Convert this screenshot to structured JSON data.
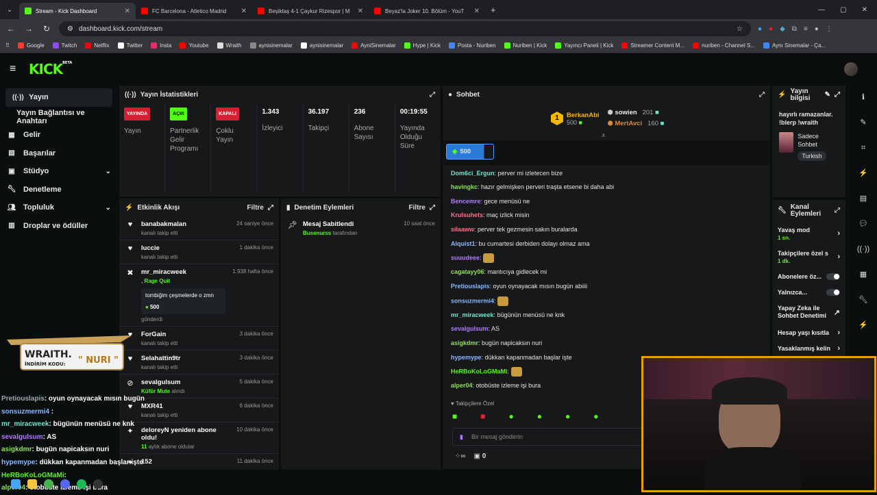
{
  "browser": {
    "tabs": [
      {
        "label": "Stream - Kick Dashboard",
        "color": "#53fc18",
        "active": true
      },
      {
        "label": "FC Barcelona - Atletico Madrid",
        "color": "#ff0000",
        "active": false
      },
      {
        "label": "Beşiktaş 4-1 Çaykur Rizespor | M",
        "color": "#ff0000",
        "active": false
      },
      {
        "label": "Beyaz'la Joker 10. Bölüm - YouT",
        "color": "#ff0000",
        "active": false
      }
    ],
    "url": "dashboard.kick.com/stream",
    "bookmarks": [
      "Google",
      "Twitch",
      "Netflix",
      "Twitter",
      "Insta",
      "Youtube",
      "Wraith",
      "aynisinemalar",
      "aynisinemalar",
      "AyniSinemalar",
      "Hype | Kick",
      "Posta - Nuriben",
      "Nuriben | Kick",
      "Yayıncı Paneli | Kick",
      "Streamer Content M...",
      "nuriben - Channel S...",
      "Aynı Sinemalar - Ça..."
    ]
  },
  "logo": {
    "text": "KICK",
    "beta": "BETA"
  },
  "sidebar": {
    "items": [
      {
        "label": "Yayın",
        "icon": "broadcast-icon",
        "active": true
      },
      {
        "label": "Yayın Bağlantısı ve Anahtarı",
        "sub": true
      },
      {
        "label": "Gelir",
        "icon": "revenue-icon"
      },
      {
        "label": "Başarılar",
        "icon": "achievements-icon"
      },
      {
        "label": "Stüdyo",
        "icon": "studio-icon",
        "chevron": true
      },
      {
        "label": "Denetleme",
        "icon": "wrench-icon"
      },
      {
        "label": "Topluluk",
        "icon": "community-icon",
        "chevron": true
      },
      {
        "label": "Droplar ve ödüller",
        "icon": "gift-icon"
      }
    ]
  },
  "stats": {
    "title": "Yayın İstatistikleri",
    "items": [
      {
        "badge": "YAYINDA",
        "badge_color": "red",
        "label": "Yayın"
      },
      {
        "badge": "AÇIK",
        "badge_color": "green",
        "label": "Partnerlik Gelir Programı"
      },
      {
        "badge": "KAPALI",
        "badge_color": "red",
        "label": "Çoklu Yayın"
      },
      {
        "value": "1.343",
        "label": "İzleyici"
      },
      {
        "value": "36.197",
        "label": "Takipçi"
      },
      {
        "value": "236",
        "label": "Abone Sayısı"
      },
      {
        "value": "00:19:55",
        "label": "Yayında Olduğu Süre"
      }
    ]
  },
  "activity": {
    "title": "Etkinlik Akışı",
    "filter": "Filtre",
    "events": [
      {
        "name": "banabakmalan",
        "sub": "kanalı takip etti",
        "time": "24 saniye önce",
        "icon": "heart"
      },
      {
        "name": "luccie",
        "sub": "kanalı takip etti",
        "time": "1 dakika önce",
        "icon": "heart"
      },
      {
        "name": "mr_miracweek",
        "sub2": ", Rage Quit",
        "time": "1.938 hafta önce",
        "icon": "kick",
        "gift_text": "tombiğim çeşmelerde o zmn",
        "gift_amount": "500",
        "gift_sub": "gönderdi"
      },
      {
        "name": "ForGain",
        "sub": "kanalı takip etti",
        "time": "3 dakika önce",
        "icon": "heart"
      },
      {
        "name": "Selahattin9tr",
        "sub": "kanalı takip etti",
        "time": "3 dakika önce",
        "icon": "heart"
      },
      {
        "name": "sevalgulsum",
        "sub2": "Küfür Mute",
        "sub3": " alındı",
        "time": "5 dakika önce",
        "icon": "mute"
      },
      {
        "name": "MXR41",
        "sub": "kanalı takip etti",
        "time": "6 dakika önce",
        "icon": "heart"
      },
      {
        "name": "deloreyN yeniden abone oldu!",
        "sub2": "11",
        "sub3": " aylık abone oldular",
        "time": "10 dakika önce",
        "icon": "star"
      },
      {
        "name": "152",
        "time": "11 dakika önce",
        "icon": "star"
      }
    ]
  },
  "moderation": {
    "title": "Denetim Eylemleri",
    "filter": "Filtre",
    "item": {
      "title": "Mesaj Sabitlendi",
      "user": "Busenurss",
      "suffix": " tarafından",
      "time": "10 saat önce"
    }
  },
  "chat": {
    "title": "Sohbet",
    "top": [
      {
        "rank": "1",
        "name": "BerkanAbi",
        "amount": "500"
      },
      {
        "rank": "2",
        "name": "sowien",
        "amount": "201"
      },
      {
        "rank": "3",
        "name": "MertAvci",
        "amount": "160"
      }
    ],
    "pinned_amount": "500",
    "messages": [
      {
        "user": "Dom6ci_Ergun",
        "color": "#6ee7c5",
        "text": "perver mi izletecen bize"
      },
      {
        "user": "havingkc",
        "color": "#8ee05a",
        "text": "hazır gelmişken perveri traşta etsene bi daha abi"
      },
      {
        "user": "Bencemre",
        "color": "#b47aff",
        "text": "gece menüsü ne"
      },
      {
        "user": "Krulsuhets",
        "color": "#ff6e8a",
        "text": "maç izlick misin"
      },
      {
        "user": "silaaww",
        "color": "#ff6e8a",
        "text": "perver tek gezmesin sakın buralarda"
      },
      {
        "user": "Alquist1",
        "color": "#8ab8ff",
        "text": "bu cumartesi derbiden dolayı olmaz ama"
      },
      {
        "user": "suuudeee",
        "color": "#b47aff",
        "text": "",
        "emote": true
      },
      {
        "user": "cagatayy06",
        "color": "#8ee05a",
        "text": "mantıcıya gidlecek mi"
      },
      {
        "user": "Pretiouslapis",
        "color": "#8ab8ff",
        "text": "oyun oynayacak mısın bugün abiiii"
      },
      {
        "user": "sonsuzmermi4",
        "color": "#8ab8ff",
        "text": "",
        "emote": true
      },
      {
        "user": "mr_miracweek",
        "color": "#6ee7c5",
        "text": "bügünün menüsü ne knk"
      },
      {
        "user": "sevalgulsum",
        "color": "#b47aff",
        "text": "AS"
      },
      {
        "user": "asigkdmr",
        "color": "#8ee05a",
        "text": "bugün napicaksın nuri"
      },
      {
        "user": "hypemype",
        "color": "#8ab8ff",
        "text": "dükkan kapanmadan başlar işte"
      },
      {
        "user": "HeRBoKoLoGMaMi",
        "color": "#53fc18",
        "text": "",
        "emote": true
      },
      {
        "user": "alper04",
        "color": "#8ee05a",
        "text": "otobüste izleme işi bura"
      }
    ],
    "followers_only": "Takipçilere Özel",
    "input_placeholder": "Bir mesaj gönderin",
    "footer_count": "0"
  },
  "stream_info": {
    "title": "Yayın bilgisi",
    "text": "hayırlı ramazanlar. !blerp !wraith",
    "mode": "Sadece Sohbet",
    "language": "Turkish"
  },
  "channel_actions": {
    "title": "Kanal Eylemleri",
    "rows": [
      {
        "label": "Yavaş mod",
        "value": "1 sn.",
        "type": "chevron"
      },
      {
        "label": "Takipçilere özel s",
        "value": "1 dk.",
        "type": "chevron"
      },
      {
        "label": "Abonelere öz...",
        "type": "toggle"
      },
      {
        "label": "Yalnızca...",
        "type": "toggle"
      },
      {
        "label": "Yapay Zeka ile Sohbet Denetimi",
        "type": "link"
      },
      {
        "label": "Hesap yaşı kısıtla",
        "type": "chevron"
      },
      {
        "label": "Yasaklanmış kelin",
        "type": "chevron"
      }
    ]
  },
  "overlay": {
    "wraith_title": "WRAITH.",
    "wraith_sub": "İNDİRİM KODU:",
    "wraith_code": "\" NURI \"",
    "chat": [
      {
        "user": "Pretiouslapis",
        "text": ": oyun oynayacak mısın bugün",
        "color": "#9aa"
      },
      {
        "user": "sonsuzmermi4",
        "text": " :",
        "color": "#8ab8ff"
      },
      {
        "user": "mr_miracweek",
        "text": ": bügünün menüsü ne knk",
        "color": "#6ee7c5"
      },
      {
        "user": "sevalgulsum",
        "text": ": AS",
        "color": "#b47aff"
      },
      {
        "user": "asigkdmr",
        "text": ": bugün napicaksın nuri",
        "color": "#8ee05a"
      },
      {
        "user": "hypemype",
        "text": ": dükkan kapanmadan başlar işte",
        "color": "#8ab8ff"
      },
      {
        "user": "HeRBoKoLoGMaMi",
        "text": ": ",
        "color": "#53fc18"
      },
      {
        "user": "alper04",
        "text": ": otobüste izleme işi bura",
        "color": "#8ee05a"
      }
    ]
  },
  "colors": {
    "brand": "#53fc18",
    "panel": "#16181a",
    "bg": "#0b0e0f",
    "cam_border": "#e8a000"
  }
}
